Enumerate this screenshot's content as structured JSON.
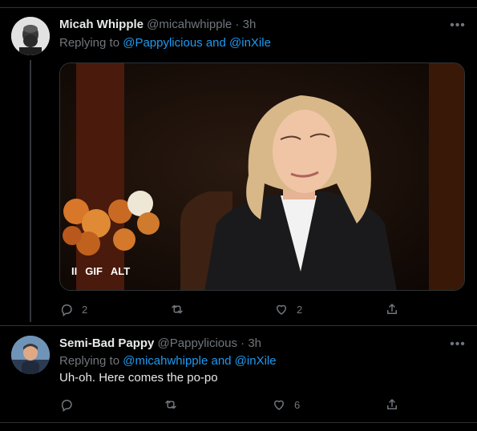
{
  "tweets": [
    {
      "name": "Micah Whipple",
      "handle": "@micahwhipple",
      "sep": "·",
      "time": "3h",
      "replying_prefix": "Replying to",
      "replying_to": "@Pappylicious and @inXile",
      "media": {
        "pause_label": "II",
        "gif_label": "GIF",
        "alt_label": "ALT"
      },
      "counts": {
        "replies": "2",
        "retweets": "",
        "likes": "2"
      }
    },
    {
      "name": "Semi-Bad Pappy",
      "handle": "@Pappylicious",
      "sep": "·",
      "time": "3h",
      "replying_prefix": "Replying to",
      "replying_to": "@micahwhipple and @inXile",
      "text": "Uh-oh. Here comes the po-po",
      "counts": {
        "replies": "",
        "retweets": "",
        "likes": "6"
      }
    }
  ],
  "icons": [
    "more-icon",
    "reply-icon",
    "retweet-icon",
    "like-icon",
    "share-icon"
  ],
  "colors": {
    "link": "#1d9bf0",
    "muted": "#71767b",
    "text": "#e7e9ea",
    "bg": "#000000"
  }
}
